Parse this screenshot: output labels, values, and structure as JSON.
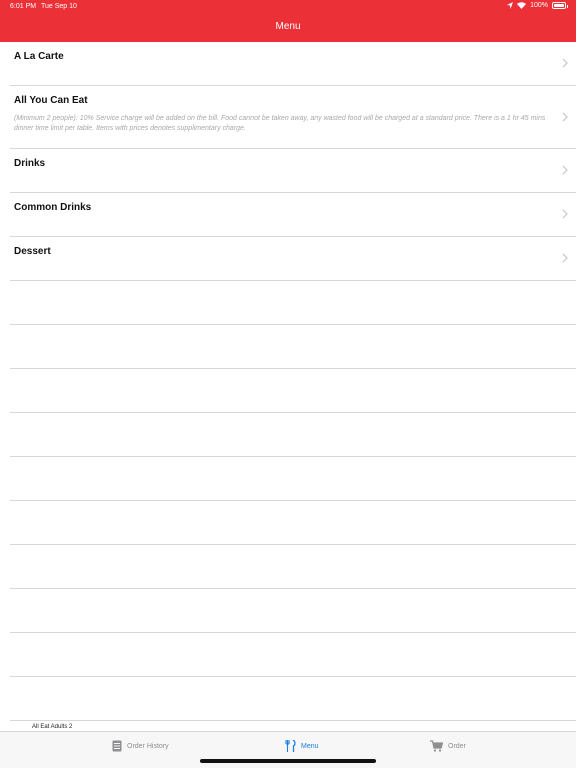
{
  "status_bar": {
    "time": "6:01 PM",
    "date": "Tue Sep 10",
    "battery": "100%"
  },
  "nav": {
    "title": "Menu"
  },
  "menu_items": [
    {
      "title": "A La Carte",
      "description": ""
    },
    {
      "title": "All You Can Eat",
      "description": "(Minimum 2 people): 10% Service charge will be added on the bill. Food cannot be taken away, any wasted food will be charged at a standard price. There is a 1 hr 45 mins dinner time limit per table. Items with prices denotes supplimentary charge."
    },
    {
      "title": "Drinks",
      "description": ""
    },
    {
      "title": "Common Drinks",
      "description": ""
    },
    {
      "title": "Dessert",
      "description": ""
    }
  ],
  "footer_note": "All Eat Adults 2",
  "tabs": [
    {
      "label": "Order History",
      "icon": "order-history-icon"
    },
    {
      "label": "Menu",
      "icon": "fork-knife-icon"
    },
    {
      "label": "Order",
      "icon": "cart-icon"
    }
  ],
  "colors": {
    "header": "#ec3038",
    "active_tab": "#1a7ee6",
    "inactive_tab": "#8e8e93"
  }
}
